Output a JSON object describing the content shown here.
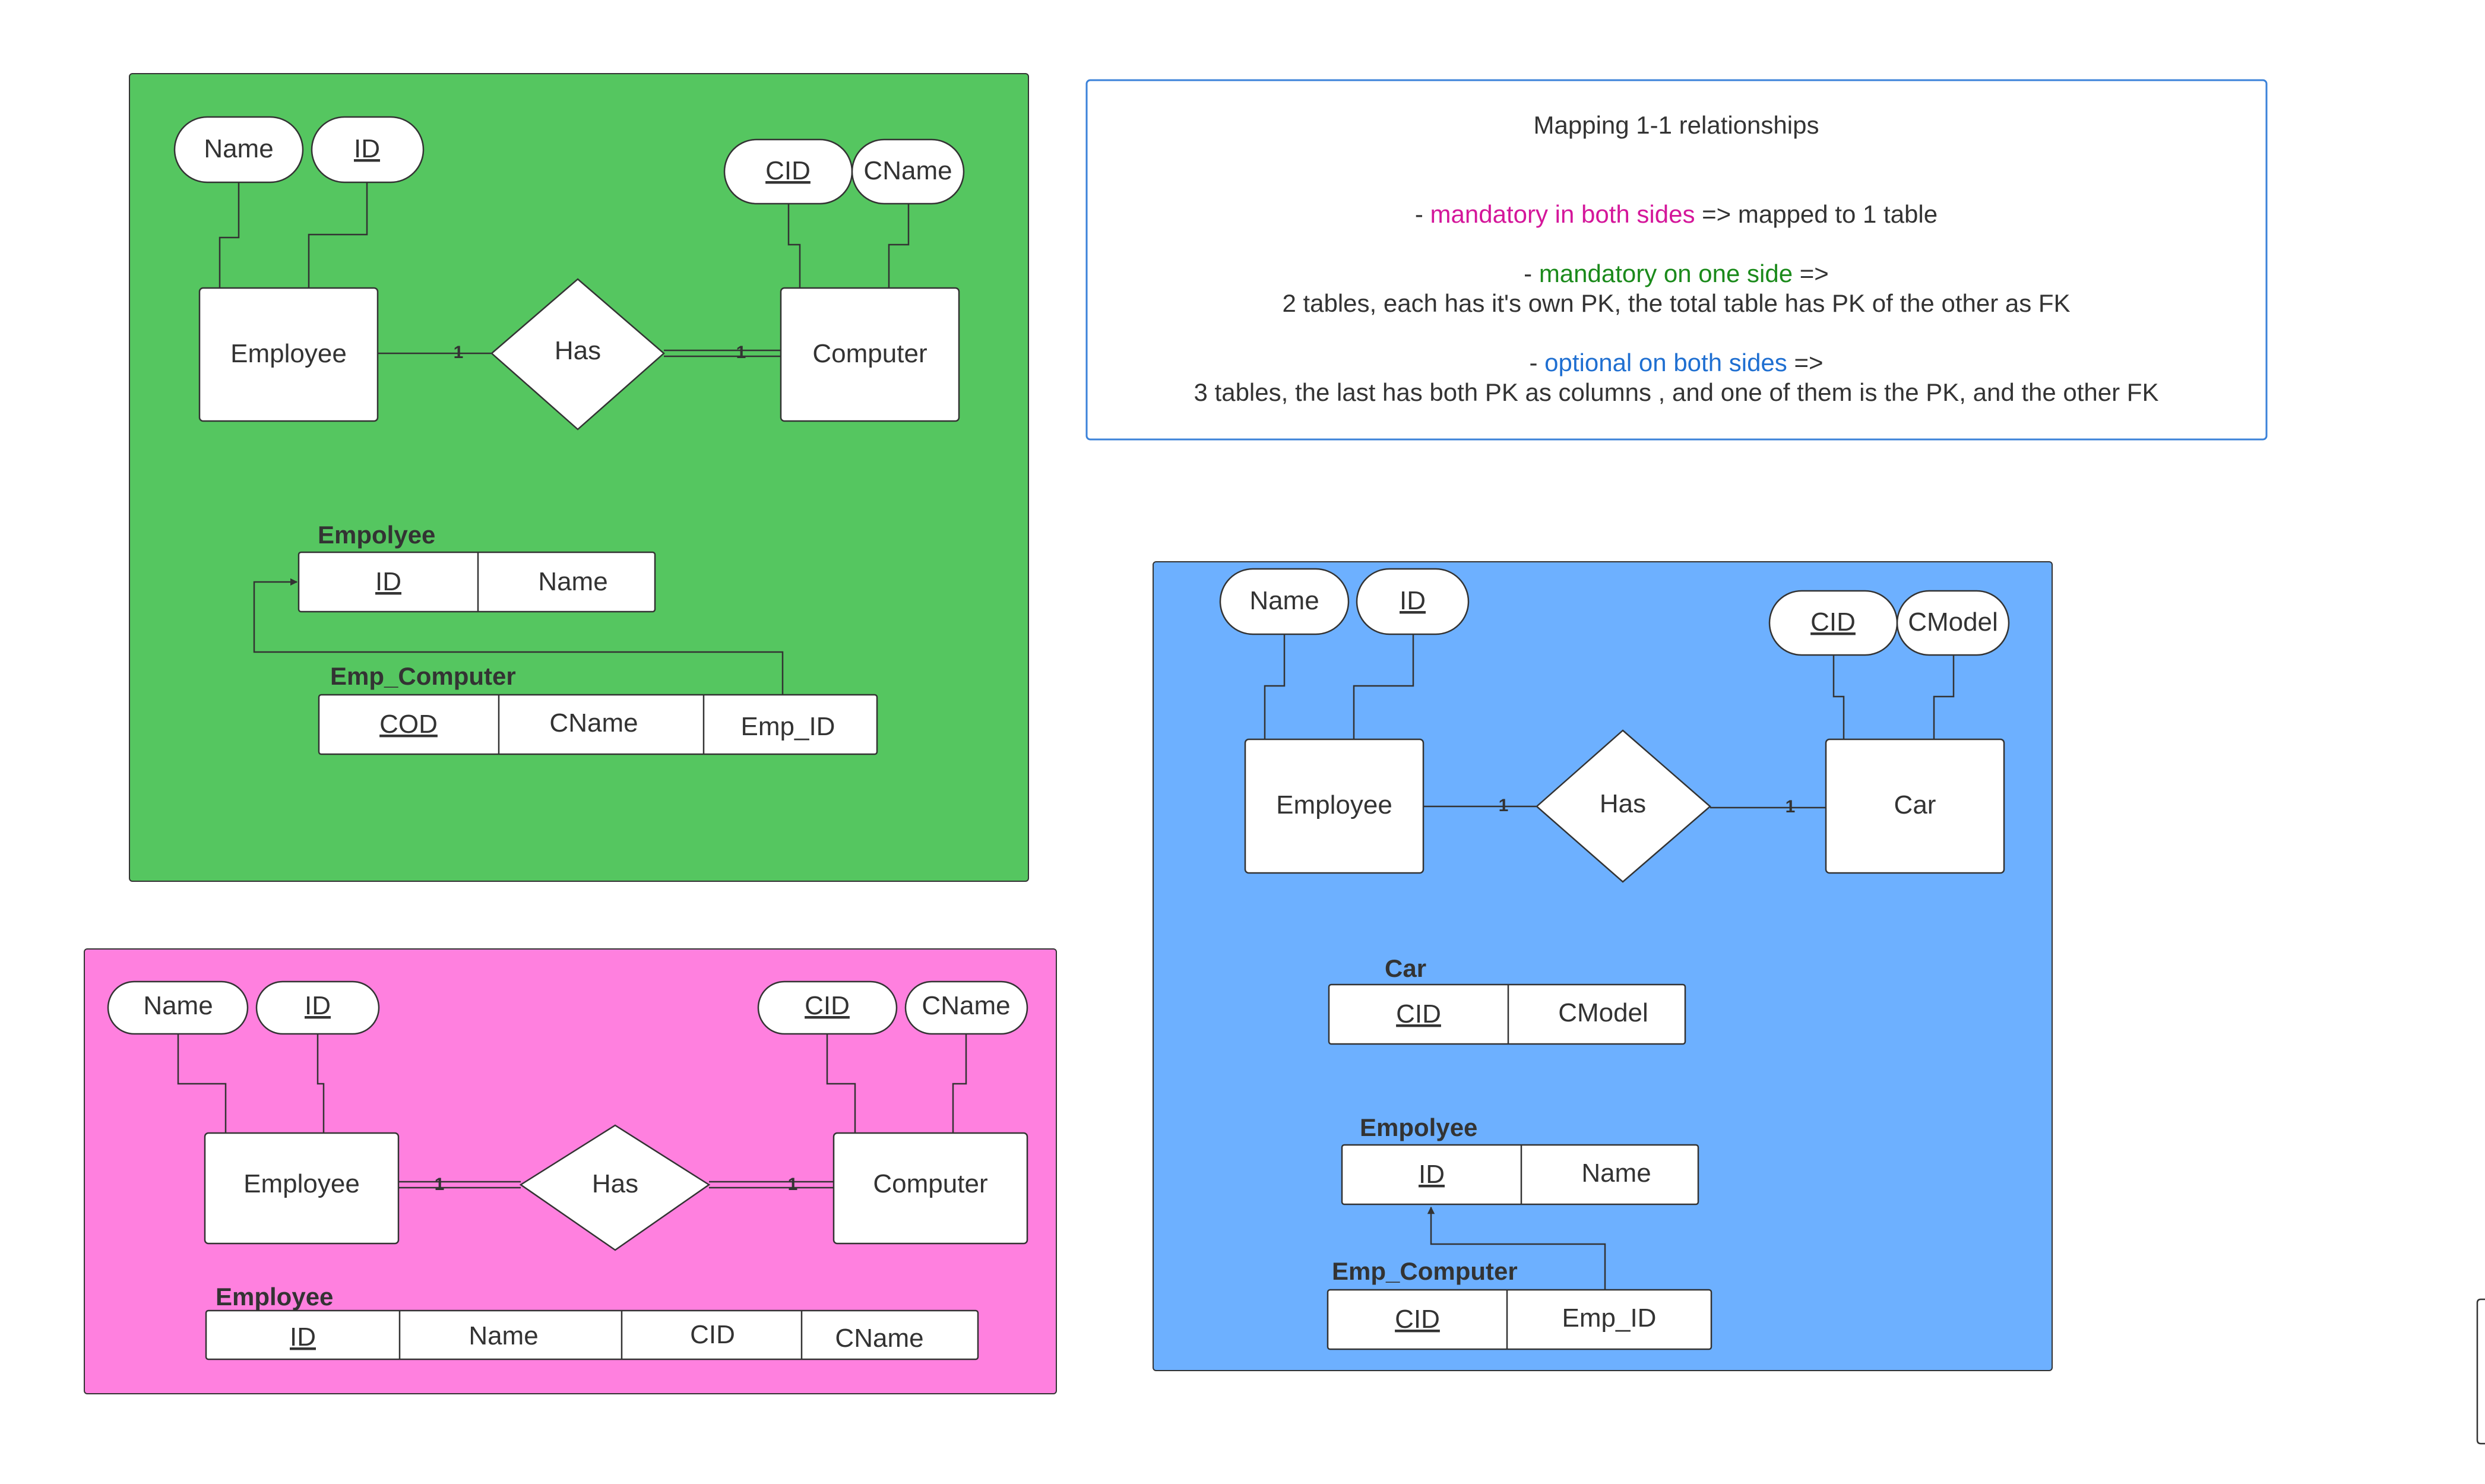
{
  "colors": {
    "green": "#55c660",
    "pink": "#ff80df",
    "blue": "#6db0ff",
    "magenta_text": "#d4169a",
    "green_text": "#1b8a1b",
    "blue_text": "#1f6fd1",
    "note_border": "#3b82d9"
  },
  "note": {
    "title": "Mapping 1-1 relationships",
    "l1_dash": "- ",
    "l1_colored": "mandatory in both sides",
    "l1_rest": " => mapped to 1 table",
    "l2_dash": "- ",
    "l2_colored": "mandatory on one side",
    "l2_rest": " =>",
    "l3": "2 tables, each has it's own PK, the total table has PK of the other as FK",
    "l4_dash": "- ",
    "l4_colored": "optional on both sides",
    "l4_rest": " =>",
    "l5": "3 tables, the last has both PK as columns , and one of them is the PK, and the other FK"
  },
  "green": {
    "attr_name": "Name",
    "attr_id": "ID",
    "attr_cid": "CID",
    "attr_cname": "CName",
    "entity1": "Employee",
    "relation": "Has",
    "entity2": "Computer",
    "card1": "1",
    "card2": "1",
    "table1_name": "Empolyee",
    "table1_cols": [
      "ID",
      "Name"
    ],
    "table2_name": "Emp_Computer",
    "table2_cols": [
      "COD",
      "CName",
      "Emp_ID"
    ]
  },
  "pink": {
    "attr_name": "Name",
    "attr_id": "ID",
    "attr_cid": "CID",
    "attr_cname": "CName",
    "entity1": "Employee",
    "relation": "Has",
    "entity2": "Computer",
    "card1": "1",
    "card2": "1",
    "table_name": "Employee",
    "table_cols": [
      "ID",
      "Name",
      "CID",
      "CName"
    ]
  },
  "blue": {
    "attr_name": "Name",
    "attr_id": "ID",
    "attr_cid": "CID",
    "attr_cmodel": "CModel",
    "entity1": "Employee",
    "relation": "Has",
    "entity2": "Car",
    "card1": "1",
    "card2": "1",
    "table1_name": "Car",
    "table1_cols": [
      "CID",
      "CModel"
    ],
    "table2_name": "Empolyee",
    "table2_cols": [
      "ID",
      "Name"
    ],
    "table3_name": "Emp_Computer",
    "table3_cols": [
      "CID",
      "Emp_ID"
    ]
  }
}
